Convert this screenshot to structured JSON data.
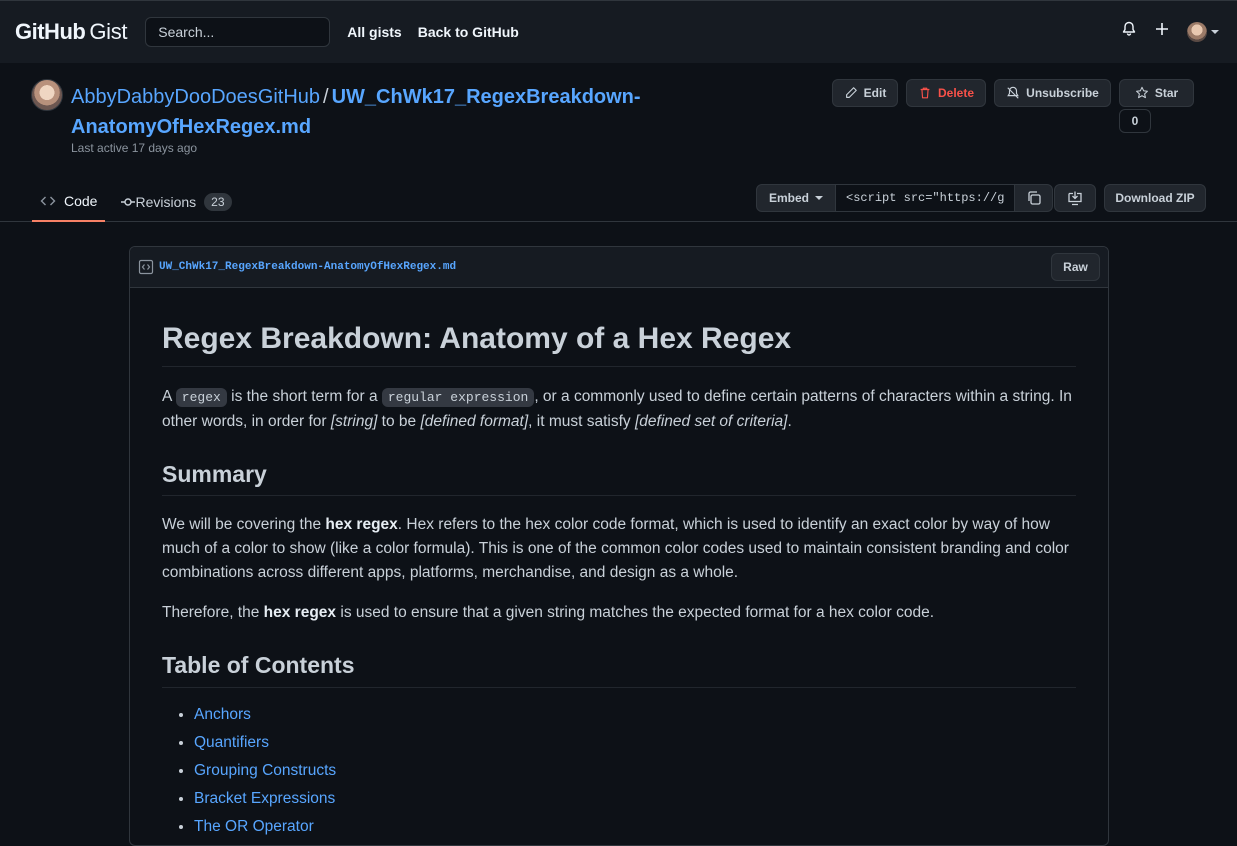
{
  "header": {
    "logo_github": "GitHub",
    "logo_gist": "Gist",
    "search_placeholder": "Search...",
    "nav": [
      "All gists",
      "Back to GitHub"
    ],
    "icons": [
      "bell-icon",
      "plus-icon",
      "avatar"
    ]
  },
  "gist": {
    "author": "AbbyDabbyDooDoesGitHub",
    "separator": "/",
    "filename_title": "UW_ChWk17_RegexBreakdown-AnatomyOfHexRegex.md",
    "last_active": "Last active 17 days ago",
    "actions": {
      "edit": "Edit",
      "delete": "Delete",
      "unsubscribe": "Unsubscribe",
      "star": "Star",
      "star_count": "0"
    }
  },
  "tabs": {
    "code": "Code",
    "revisions": "Revisions",
    "revisions_count": "23"
  },
  "toolbar": {
    "embed": "Embed",
    "embed_value": "<script src=\"https://gist.github.com/AbbyDabbyDooDoesGitHub",
    "download_zip": "Download ZIP"
  },
  "file": {
    "name": "UW_ChWk17_RegexBreakdown-AnatomyOfHexRegex.md",
    "raw": "Raw"
  },
  "markdown": {
    "h1": "Regex Breakdown: Anatomy of a Hex Regex",
    "intro": {
      "t1": "A ",
      "c1": "regex",
      "t2": " is the short term for a ",
      "c2": "regular expression",
      "t3": ", or a commonly used to define certain patterns of characters within a string. In other words, in order for ",
      "e1": "[string]",
      "t4": " to be ",
      "e2": "[defined format]",
      "t5": ", it must satisfy ",
      "e3": "[defined set of criteria]",
      "t6": "."
    },
    "summary_heading": "Summary",
    "summary_p1": {
      "t1": "We will be covering the ",
      "b1": "hex regex",
      "t2": ". Hex refers to the hex color code format, which is used to identify an exact color by way of how much of a color to show (like a color formula). This is one of the common color codes used to maintain consistent branding and color combinations across different apps, platforms, merchandise, and design as a whole."
    },
    "summary_p2": {
      "t1": "Therefore, the ",
      "b1": "hex regex",
      "t2": " is used to ensure that a given string matches the expected format for a hex color code."
    },
    "toc_heading": "Table of Contents",
    "toc": [
      "Anchors",
      "Quantifiers",
      "Grouping Constructs",
      "Bracket Expressions",
      "The OR Operator"
    ]
  },
  "colors": {
    "background": "#0d1117",
    "header_bg": "#161b22",
    "link": "#58a6ff",
    "danger": "#f85149",
    "tab_underline": "#f78166"
  }
}
